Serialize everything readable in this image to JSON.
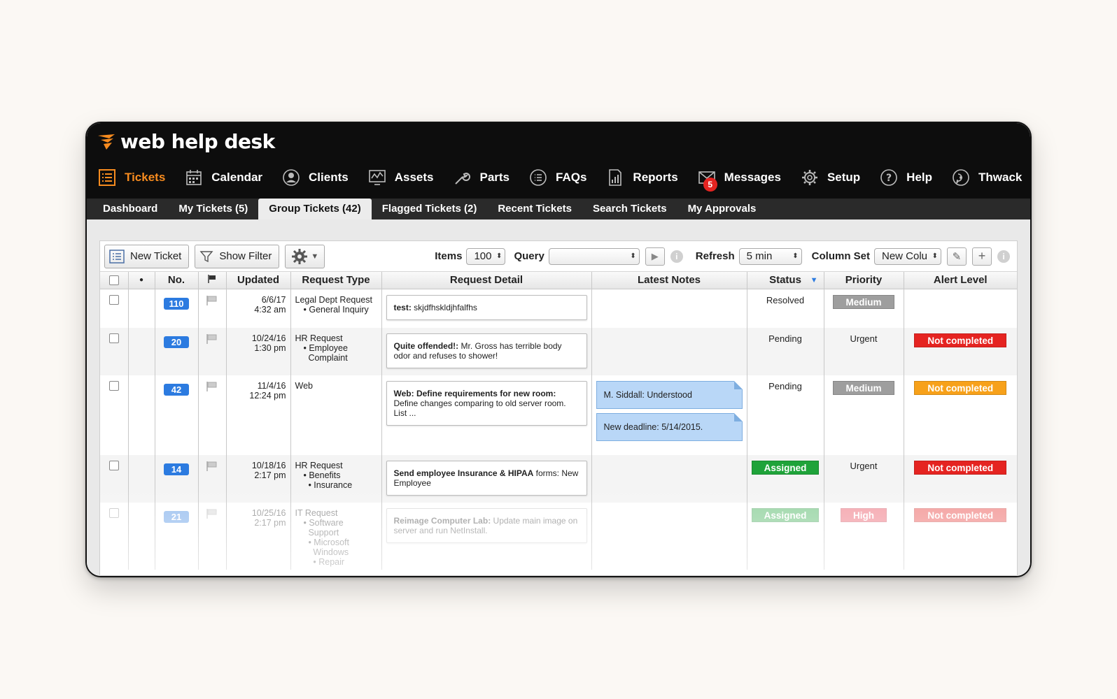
{
  "brand": {
    "name": "web help desk",
    "logo_mark_color": "#f68b1f"
  },
  "nav": [
    {
      "label": "Tickets",
      "icon": "list-icon",
      "active": true
    },
    {
      "label": "Calendar",
      "icon": "calendar-icon"
    },
    {
      "label": "Clients",
      "icon": "user-icon"
    },
    {
      "label": "Assets",
      "icon": "monitor-chart-icon"
    },
    {
      "label": "Parts",
      "icon": "wrench-icon"
    },
    {
      "label": "FAQs",
      "icon": "faq-list-icon"
    },
    {
      "label": "Reports",
      "icon": "report-icon"
    },
    {
      "label": "Messages",
      "icon": "envelope-icon",
      "badge": "5"
    },
    {
      "label": "Setup",
      "icon": "gear-icon"
    },
    {
      "label": "Help",
      "icon": "help-icon"
    },
    {
      "label": "Thwack",
      "icon": "thwack-icon"
    }
  ],
  "subtabs": [
    {
      "label": "Dashboard"
    },
    {
      "label": "My Tickets (5)"
    },
    {
      "label": "Group Tickets (42)",
      "active": true
    },
    {
      "label": "Flagged Tickets (2)"
    },
    {
      "label": "Recent Tickets"
    },
    {
      "label": "Search Tickets"
    },
    {
      "label": "My Approvals"
    }
  ],
  "toolbar": {
    "new_ticket": "New Ticket",
    "show_filter": "Show Filter",
    "items_label": "Items",
    "items_value": "100",
    "query_label": "Query",
    "query_value": "",
    "refresh_label": "Refresh",
    "refresh_value": "5 min",
    "column_set_label": "Column Set",
    "column_set_value": "New Colu"
  },
  "columns": {
    "dot": "●",
    "no": "No.",
    "updated": "Updated",
    "request_type": "Request Type",
    "request_detail": "Request Detail",
    "latest_notes": "Latest Notes",
    "status": "Status",
    "priority": "Priority",
    "alert_level": "Alert Level"
  },
  "colors": {
    "accent": "#f68b1f",
    "ticket_number": "#2c7be0",
    "priority_medium": "#9e9e9e",
    "priority_high": "#e8374a",
    "alert_red": "#e52421",
    "alert_orange": "#f7a11a",
    "status_assigned": "#1fa33a",
    "note_blue": "#b9d7f7"
  },
  "rows": [
    {
      "no": "110",
      "date": "6/6/17",
      "time": "4:32 am",
      "type": "Legal Dept Request",
      "sub": [
        "• General Inquiry"
      ],
      "detail_bold": "test:",
      "detail_rest": " skjdfhskldjhfalfhs",
      "notes": [],
      "status": "Resolved",
      "status_style": "text",
      "priority": "Medium",
      "priority_style": "medium",
      "alert": "",
      "alert_style": "none"
    },
    {
      "no": "20",
      "date": "10/24/16",
      "time": "1:30 pm",
      "type": "HR Request",
      "sub": [
        "• Employee",
        "  Complaint"
      ],
      "detail_bold": "Quite offended!:",
      "detail_rest": " Mr. Gross has terrible body odor and refuses to shower!",
      "notes": [],
      "status": "Pending",
      "status_style": "text",
      "priority": "Urgent",
      "priority_style": "text",
      "alert": "Not completed",
      "alert_style": "red"
    },
    {
      "no": "42",
      "date": "11/4/16",
      "time": "12:24 pm",
      "type": "Web",
      "sub": [],
      "detail_bold": "Web: Define requirements for new room:",
      "detail_rest": " Define changes comparing to old server room. List ...",
      "notes": [
        "M. Siddall: Understood",
        "New deadline: 5/14/2015."
      ],
      "status": "Pending",
      "status_style": "text",
      "priority": "Medium",
      "priority_style": "medium",
      "alert": "Not completed",
      "alert_style": "orange"
    },
    {
      "no": "14",
      "date": "10/18/16",
      "time": "2:17 pm",
      "type": "HR Request",
      "sub": [
        "• Benefits",
        "  • Insurance"
      ],
      "detail_bold": "Send employee Insurance & HIPAA",
      "detail_rest": " forms: New Employee",
      "notes": [],
      "status": "Assigned",
      "status_style": "assigned",
      "priority": "Urgent",
      "priority_style": "text",
      "alert": "Not completed",
      "alert_style": "red"
    },
    {
      "no": "21",
      "date": "10/25/16",
      "time": "2:17 pm",
      "type": "IT Request",
      "sub": [
        "• Software",
        "  Support",
        "  • Microsoft",
        "    Windows",
        "    • Repair"
      ],
      "detail_bold": "Reimage Computer Lab:",
      "detail_rest": " Update main image on server and run NetInstall.",
      "notes": [],
      "status": "Assigned",
      "status_style": "assigned",
      "priority": "High",
      "priority_style": "high",
      "alert": "Not completed",
      "alert_style": "red"
    }
  ]
}
